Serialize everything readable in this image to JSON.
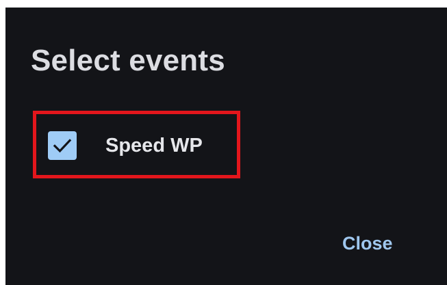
{
  "dialog": {
    "title": "Select events",
    "options": [
      {
        "label": "Speed WP",
        "checked": true
      }
    ],
    "close_label": "Close"
  },
  "colors": {
    "background": "#131418",
    "title_text": "#dcdde2",
    "checkbox_fill": "#9fccf6",
    "checkmark": "#131418",
    "highlight_border": "#e3161c",
    "close_text": "#9fc7ee"
  },
  "icons": {
    "checkbox_state": "checkmark-icon"
  }
}
